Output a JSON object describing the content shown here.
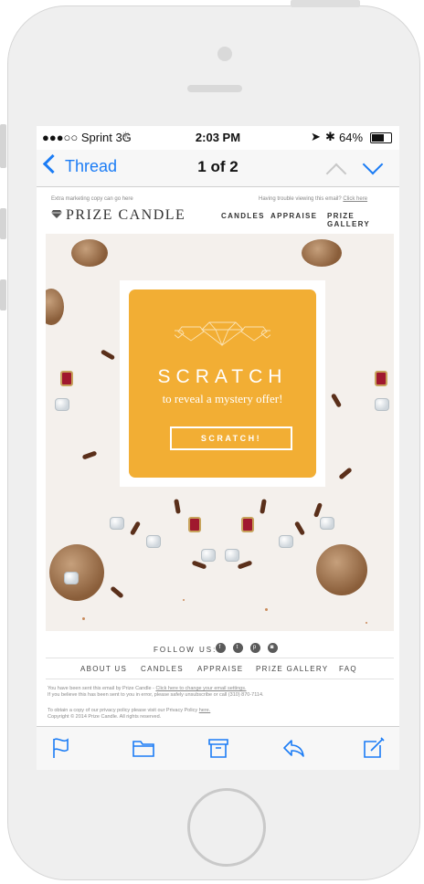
{
  "status": {
    "carrier": "●●●○○ Sprint  3G",
    "time": "2:03 PM",
    "battery": "64%"
  },
  "nav": {
    "back_label": "Thread",
    "title": "1 of 2"
  },
  "email": {
    "pre_header_left": "Extra marketing copy can go here",
    "pre_header_right": "Having trouble viewing this email?",
    "pre_header_link": "Click here",
    "brand": "PRIZE CANDLE",
    "top_nav": [
      "CANDLES",
      "APPRAISE",
      "PRIZE GALLERY"
    ],
    "hero": {
      "title": "SCRATCH",
      "subtitle": "to reveal a mystery offer!",
      "button": "SCRATCH!"
    },
    "follow_label": "FOLLOW US:",
    "social": [
      "f",
      "t",
      "p",
      "◙"
    ],
    "footer_nav": [
      "ABOUT US",
      "CANDLES",
      "APPRAISE",
      "PRIZE GALLERY",
      "FAQ"
    ],
    "legal_1": "You have been sent this email by Prize Candle -",
    "legal_1_link": "Click here to change your email settings.",
    "legal_2": "If you believe this has been sent to you in error, please safely unsubscribe or call (310) 870-7114.",
    "legal_3": "To obtain a copy of our privacy policy please visit our Privacy Policy",
    "legal_3_link": "here.",
    "legal_4": "Copyright © 2014 Prize Candle. All rights reserved."
  },
  "colors": {
    "ios_blue": "#1b7cf5",
    "accent_orange": "#f2ae34"
  },
  "toolbar": {
    "icons": [
      "flag-icon",
      "folder-icon",
      "archive-icon",
      "reply-icon",
      "compose-icon"
    ]
  }
}
